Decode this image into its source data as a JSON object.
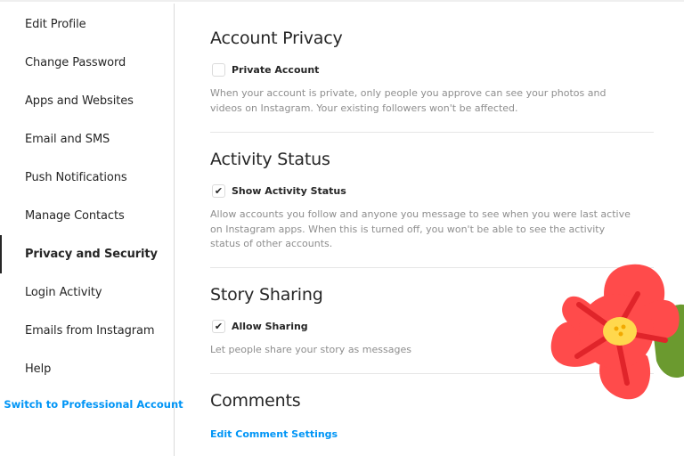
{
  "sidebar": {
    "items": [
      {
        "label": "Edit Profile",
        "active": false
      },
      {
        "label": "Change Password",
        "active": false
      },
      {
        "label": "Apps and Websites",
        "active": false
      },
      {
        "label": "Email and SMS",
        "active": false
      },
      {
        "label": "Push Notifications",
        "active": false
      },
      {
        "label": "Manage Contacts",
        "active": false
      },
      {
        "label": "Privacy and Security",
        "active": true
      },
      {
        "label": "Login Activity",
        "active": false
      },
      {
        "label": "Emails from Instagram",
        "active": false
      },
      {
        "label": "Help",
        "active": false
      }
    ],
    "switch_professional": "Switch to Professional Account"
  },
  "main": {
    "account_privacy": {
      "title": "Account Privacy",
      "checkbox_label": "Private Account",
      "checked": false,
      "description": "When your account is private, only people you approve can see your photos and videos on Instagram. Your existing followers won't be affected."
    },
    "activity_status": {
      "title": "Activity Status",
      "checkbox_label": "Show Activity Status",
      "checked": true,
      "description": "Allow accounts you follow and anyone you message to see when you were last active on Instagram apps. When this is turned off, you won't be able to see the activity status of other accounts."
    },
    "story_sharing": {
      "title": "Story Sharing",
      "checkbox_label": "Allow Sharing",
      "checked": true,
      "description": "Let people share your story as messages"
    },
    "comments": {
      "title": "Comments",
      "link": "Edit Comment Settings"
    }
  },
  "icons": {
    "check": "✔",
    "flower": "flower-sticker"
  },
  "colors": {
    "accent": "#0095f6",
    "text": "#262626",
    "muted": "#8e8e8e",
    "border": "#dbdbdb",
    "flower_red": "#ff4b4b",
    "flower_dark_red": "#e0242a",
    "flower_center": "#ffd84d",
    "leaf": "#6b9a2f"
  }
}
